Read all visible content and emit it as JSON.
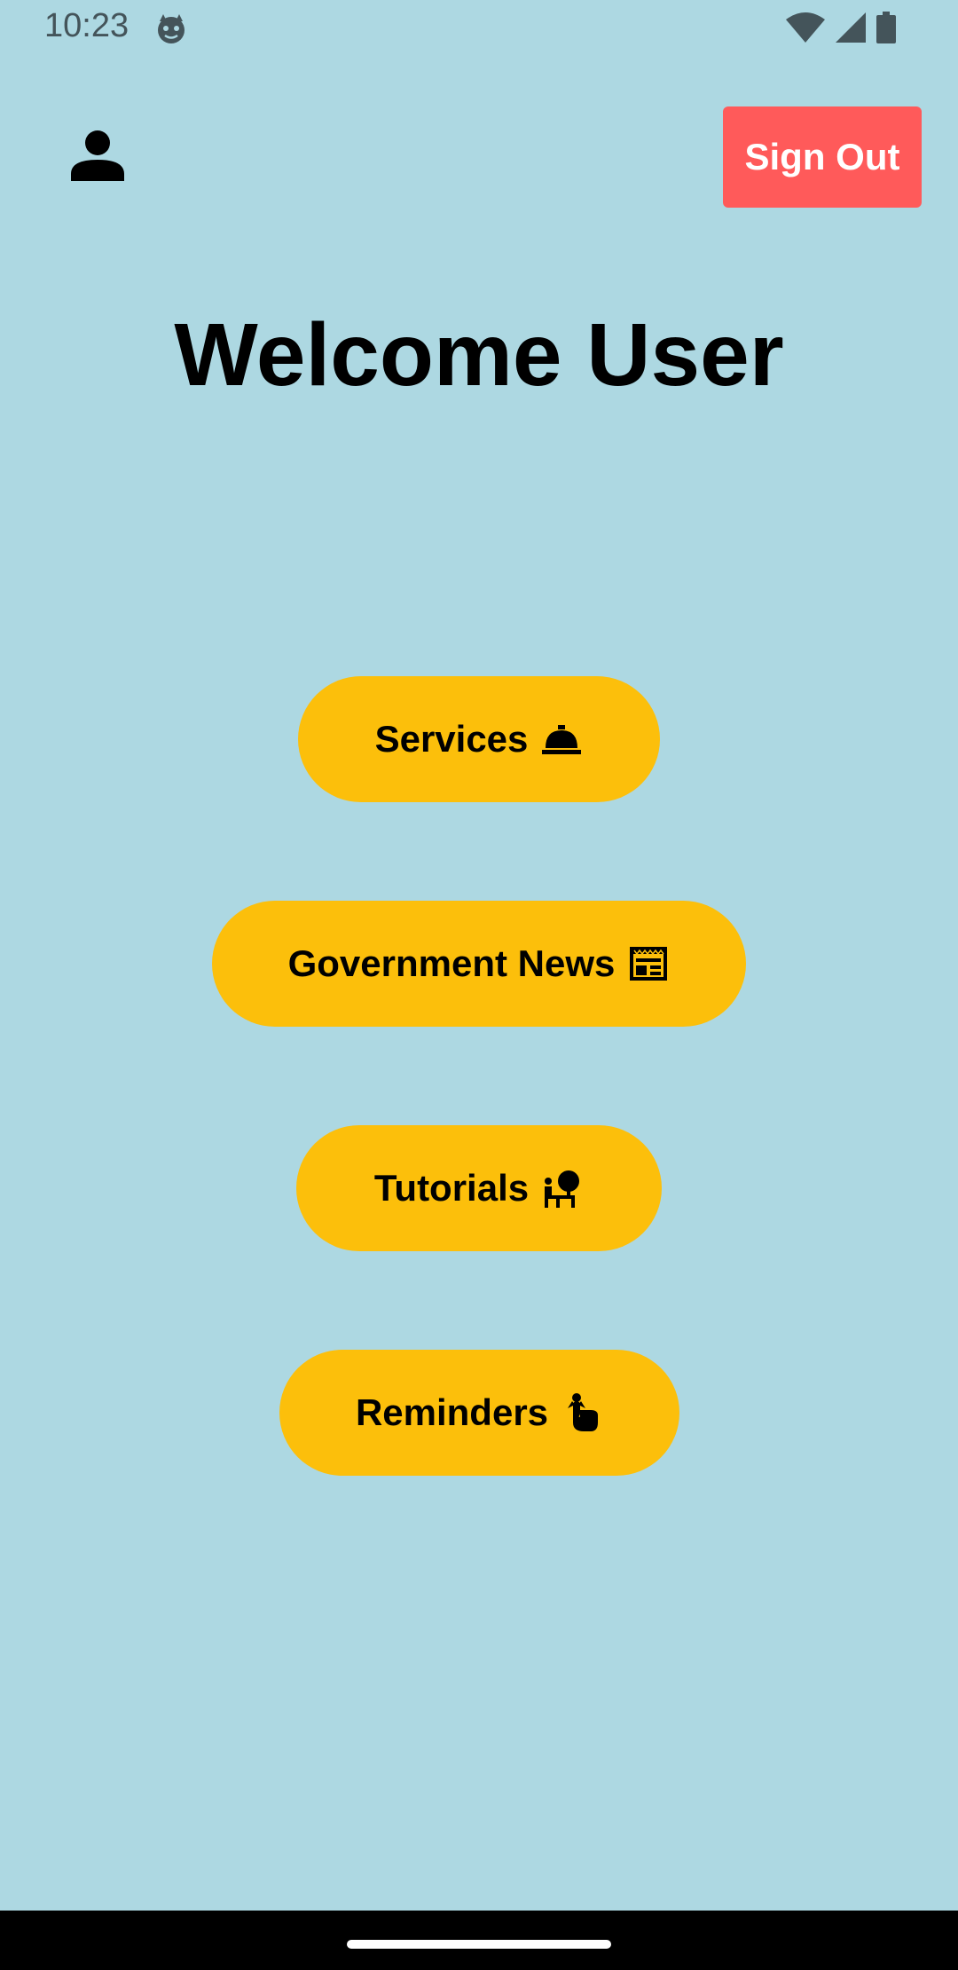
{
  "status_bar": {
    "time": "10:23",
    "app_icon": "cat-face-icon",
    "wifi_icon": "wifi-icon",
    "signal_icon": "cell-signal-icon",
    "battery_icon": "battery-icon"
  },
  "header": {
    "profile_icon": "person-icon",
    "sign_out_label": "Sign Out"
  },
  "main": {
    "title": "Welcome User",
    "buttons": [
      {
        "label": "Services",
        "icon": "room-service-icon"
      },
      {
        "label": "Government News",
        "icon": "newspaper-icon"
      },
      {
        "label": "Tutorials",
        "icon": "presenter-icon"
      },
      {
        "label": "Reminders",
        "icon": "finger-ribbon-icon"
      }
    ]
  },
  "colors": {
    "background": "#add8e2",
    "sign_out_bg": "#ff5a5a",
    "button_bg": "#fcbf0b",
    "nav_bar": "#000000"
  }
}
